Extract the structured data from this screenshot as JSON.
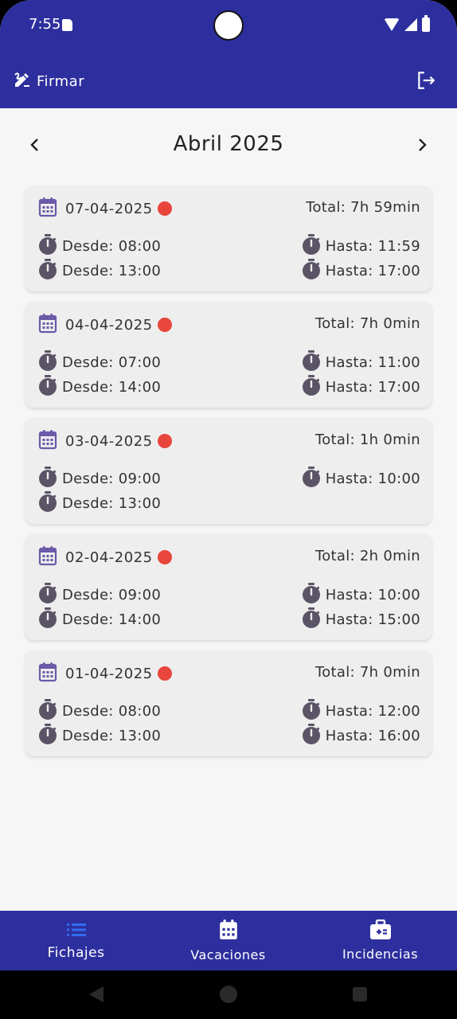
{
  "status": {
    "time": "7:55"
  },
  "appbar": {
    "sign_label": "Firmar"
  },
  "month": {
    "title": "Abril 2025"
  },
  "colors": {
    "primary": "#2e2f9e",
    "accent_icon": "#6a5aa8",
    "status_dot": "#e8453c",
    "clock_icon": "#5b5466"
  },
  "records": [
    {
      "date": "07-04-2025",
      "total": "Total: 7h 59min",
      "entries": [
        {
          "from": "Desde: 08:00",
          "to": "Hasta: 11:59"
        },
        {
          "from": "Desde: 13:00",
          "to": "Hasta: 17:00"
        }
      ]
    },
    {
      "date": "04-04-2025",
      "total": "Total: 7h 0min",
      "entries": [
        {
          "from": "Desde: 07:00",
          "to": "Hasta: 11:00"
        },
        {
          "from": "Desde: 14:00",
          "to": "Hasta: 17:00"
        }
      ]
    },
    {
      "date": "03-04-2025",
      "total": "Total: 1h 0min",
      "entries": [
        {
          "from": "Desde: 09:00",
          "to": "Hasta: 10:00"
        },
        {
          "from": "Desde: 13:00",
          "to": ""
        }
      ]
    },
    {
      "date": "02-04-2025",
      "total": "Total: 2h 0min",
      "entries": [
        {
          "from": "Desde: 09:00",
          "to": "Hasta: 10:00"
        },
        {
          "from": "Desde: 14:00",
          "to": "Hasta: 15:00"
        }
      ]
    },
    {
      "date": "01-04-2025",
      "total": "Total: 7h 0min",
      "entries": [
        {
          "from": "Desde: 08:00",
          "to": "Hasta: 12:00"
        },
        {
          "from": "Desde: 13:00",
          "to": "Hasta: 16:00"
        }
      ]
    }
  ],
  "bottom_nav": [
    {
      "label": "Fichajes",
      "icon": "list-icon",
      "active": true
    },
    {
      "label": "Vacaciones",
      "icon": "calendar-icon",
      "active": false
    },
    {
      "label": "Incidencias",
      "icon": "medical-kit-icon",
      "active": false
    }
  ]
}
